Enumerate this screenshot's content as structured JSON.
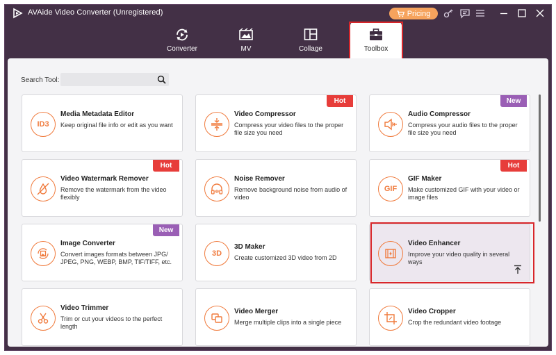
{
  "window": {
    "title": "AVAide Video Converter (Unregistered)",
    "pricing_label": "Pricing",
    "icons": [
      "key-icon",
      "chat-icon",
      "menu-icon",
      "minimize-icon",
      "maximize-icon",
      "close-icon"
    ]
  },
  "nav": {
    "tabs": [
      {
        "label": "Converter",
        "icon": "converter-icon"
      },
      {
        "label": "MV",
        "icon": "mv-icon"
      },
      {
        "label": "Collage",
        "icon": "collage-icon"
      },
      {
        "label": "Toolbox",
        "icon": "toolbox-icon",
        "active": true
      }
    ]
  },
  "search": {
    "label": "Search Tool:",
    "value": "",
    "placeholder": ""
  },
  "tools": [
    {
      "title": "Media Metadata Editor",
      "desc": "Keep original file info or edit as you want",
      "icon_text": "ID3",
      "badge": ""
    },
    {
      "title": "Video Compressor",
      "desc": "Compress your video files to the proper file size you need",
      "icon_text": "",
      "badge": "Hot"
    },
    {
      "title": "Audio Compressor",
      "desc": "Compress your audio files to the proper file size you need",
      "icon_text": "",
      "badge": "New"
    },
    {
      "title": "Video Watermark Remover",
      "desc": "Remove the watermark from the video flexibly",
      "icon_text": "",
      "badge": "Hot"
    },
    {
      "title": "Noise Remover",
      "desc": "Remove background noise from audio of video",
      "icon_text": "",
      "badge": ""
    },
    {
      "title": "GIF Maker",
      "desc": "Make customized GIF with your video or image files",
      "icon_text": "GIF",
      "badge": "Hot"
    },
    {
      "title": "Image Converter",
      "desc": "Convert images formats between JPG/ JPEG, PNG, WEBP, BMP, TIF/TIFF, etc.",
      "icon_text": "",
      "badge": "New"
    },
    {
      "title": "3D Maker",
      "desc": "Create customized 3D video from 2D",
      "icon_text": "3D",
      "badge": ""
    },
    {
      "title": "Video Enhancer",
      "desc": "Improve your video quality in several ways",
      "icon_text": "",
      "badge": ""
    },
    {
      "title": "Video Trimmer",
      "desc": "Trim or cut your videos to the perfect length",
      "icon_text": "",
      "badge": ""
    },
    {
      "title": "Video Merger",
      "desc": "Merge multiple clips into a single piece",
      "icon_text": "",
      "badge": ""
    },
    {
      "title": "Video Cropper",
      "desc": "Crop the redundant video footage",
      "icon_text": "",
      "badge": ""
    }
  ],
  "colors": {
    "window_bg": "#433046",
    "accent_orange": "#f07a3c",
    "hot_badge": "#e73d3a",
    "new_badge": "#9a5fb5",
    "pricing_bg": "#f6a35d",
    "highlight_frame": "#d8262a"
  }
}
